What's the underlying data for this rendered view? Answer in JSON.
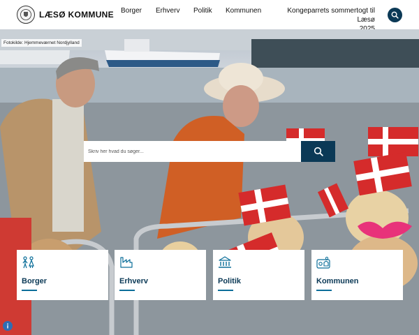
{
  "header": {
    "logo_text": "LÆSØ KOMMUNE",
    "nav": {
      "borger": "Borger",
      "erhverv": "Erhverv",
      "politik": "Politik",
      "kommunen": "Kommunen",
      "event_line1": "Kongeparrets sommertogt til Læsø",
      "event_line2": "2025"
    },
    "search_icon": "search-icon"
  },
  "hero": {
    "photo_credit": "Fotokilde: Hjemmeværnet Nordjylland",
    "search": {
      "placeholder": "Skriv her hvad du søger..."
    }
  },
  "cards": {
    "borger": {
      "label": "Borger",
      "icon": "family-icon"
    },
    "erhverv": {
      "label": "Erhverv",
      "icon": "factory-icon"
    },
    "politik": {
      "label": "Politik",
      "icon": "townhall-icon"
    },
    "kommunen": {
      "label": "Kommunen",
      "icon": "community-icon"
    }
  },
  "colors": {
    "brand_navy": "#0b3956",
    "underline": "#0b6e99",
    "info_blue": "#2f6db4"
  }
}
